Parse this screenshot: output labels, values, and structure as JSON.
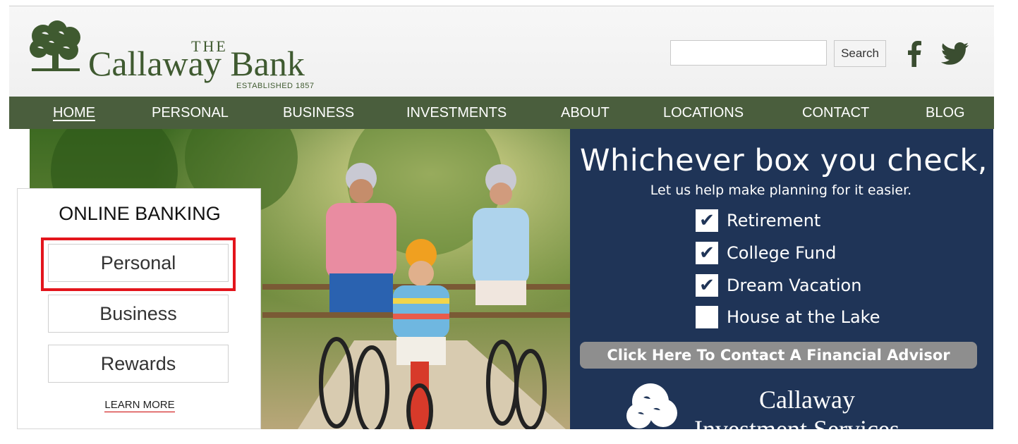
{
  "header": {
    "logo": {
      "the": "THE",
      "name": "Callaway Bank",
      "established": "ESTABLISHED 1857"
    },
    "search": {
      "value": "",
      "placeholder": "",
      "button_label": "Search"
    },
    "social": {
      "facebook_icon": "facebook-icon",
      "twitter_icon": "twitter-icon"
    }
  },
  "nav": {
    "items": [
      {
        "label": "HOME",
        "active": true
      },
      {
        "label": "PERSONAL"
      },
      {
        "label": "BUSINESS"
      },
      {
        "label": "INVESTMENTS"
      },
      {
        "label": "ABOUT"
      },
      {
        "label": "LOCATIONS"
      },
      {
        "label": "CONTACT"
      },
      {
        "label": "BLOG"
      }
    ]
  },
  "online_banking": {
    "title": "ONLINE BANKING",
    "buttons": [
      "Personal",
      "Business",
      "Rewards"
    ],
    "learn_more": "LEARN MORE"
  },
  "hero": {
    "headline": "Whichever box you check,",
    "subhead": "Let us help make planning for it easier.",
    "checklist": [
      {
        "label": "Retirement",
        "checked": true
      },
      {
        "label": "College Fund",
        "checked": true
      },
      {
        "label": "Dream Vacation",
        "checked": true
      },
      {
        "label": "House at the Lake",
        "checked": false
      }
    ],
    "check_mark": "✔",
    "cta": "Click Here To Contact A Financial Advisor",
    "investment_logo": {
      "line1": "Callaway",
      "line2": "Investment Services"
    }
  },
  "colors": {
    "brand_green": "#4a5e3d",
    "logo_green": "#3f5a30",
    "panel_navy": "#1f3457",
    "highlight_red": "#e3151c",
    "cta_gray": "#8e8e8e"
  }
}
